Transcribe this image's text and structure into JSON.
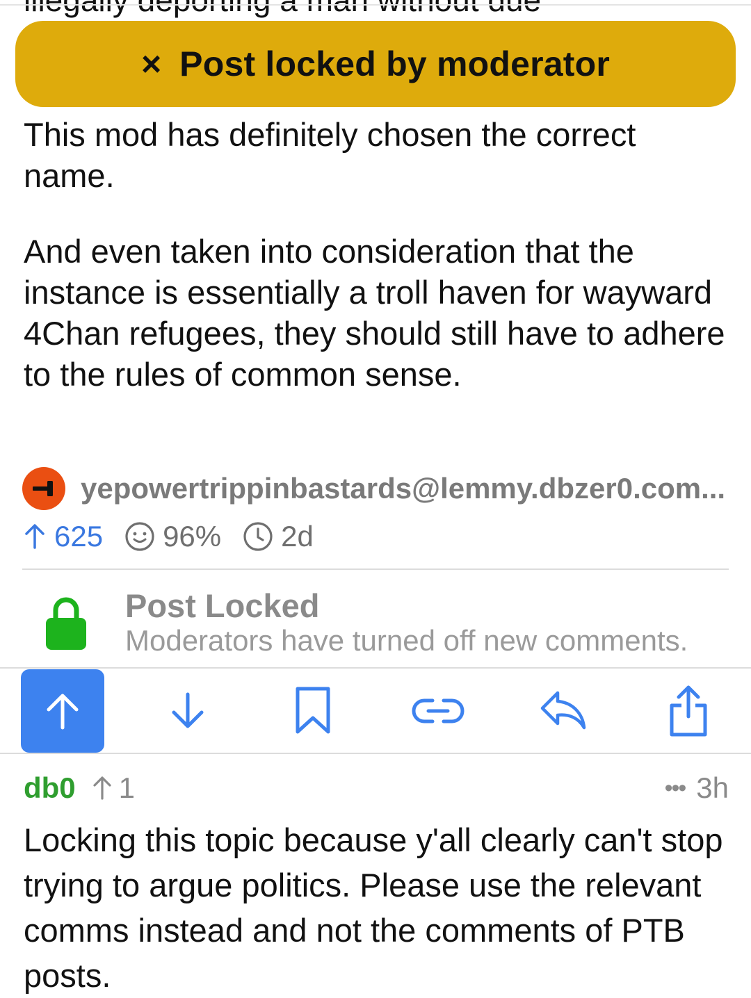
{
  "post": {
    "clipped_title_text": "illegally deporting a man without due",
    "body_paragraphs": [
      "This mod has definitely chosen the correct name.",
      "And even taken into consideration that the instance is essentially a troll haven for wayward 4Chan refugees, they should still have to adhere to the rules of common sense."
    ],
    "author": "yepowertrippinbastards@lemmy.dbzer0.com...",
    "upvotes": "625",
    "upvote_ratio": "96%",
    "age": "2d"
  },
  "banner": {
    "close_icon": "×",
    "text": "Post locked by moderator",
    "color": "#deab0c"
  },
  "locked_notice": {
    "title": "Post Locked",
    "subtitle": "Moderators have turned off new comments.",
    "icon": "lock-icon",
    "icon_color": "#1db31d"
  },
  "actions": {
    "items": [
      "upvote",
      "downvote",
      "save",
      "copy-link",
      "reply",
      "share"
    ],
    "active": "upvote",
    "accent_color": "#3d82ef"
  },
  "comment": {
    "user": "db0",
    "score": "1",
    "more_icon": "•••",
    "age": "3h",
    "body": "Locking this topic because y'all clearly can't stop trying to argue politics. Please use the relevant comms instead and not the comments of PTB posts."
  }
}
